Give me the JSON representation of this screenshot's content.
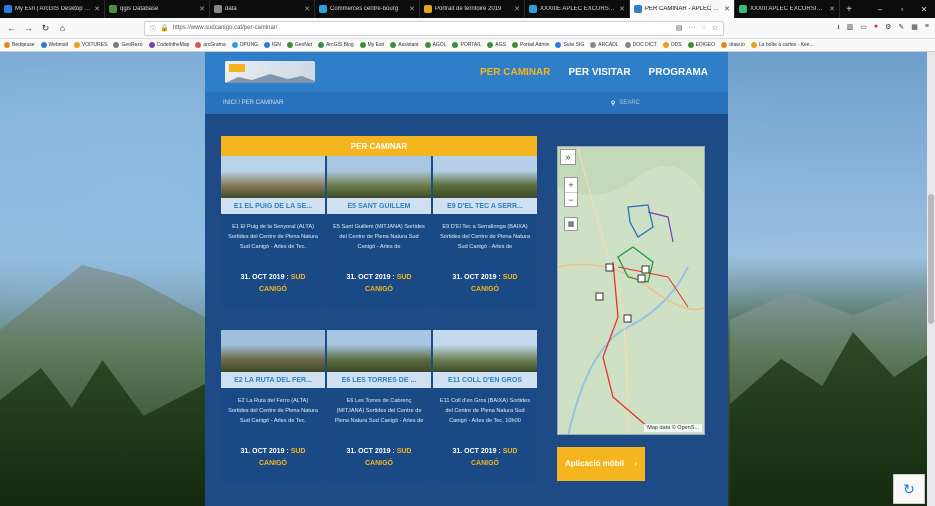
{
  "browser": {
    "tabs": [
      {
        "title": "My Esri | ArcGIS Desktop Sta",
        "color": "#2c7be5"
      },
      {
        "title": "qgis Database",
        "color": "#4a8f3f"
      },
      {
        "title": "data",
        "color": "#888888"
      },
      {
        "title": "Commerces centre-bourg",
        "color": "#2aa1d8"
      },
      {
        "title": "Portrait de territoire 2019",
        "color": "#e3a21a"
      },
      {
        "title": "XXXIIIE APLEC EXCURSIONI",
        "color": "#2aa1d8"
      },
      {
        "title": "PER CAMINAR - APLEC EXCU",
        "color": "#2f7fc8",
        "active": true
      },
      {
        "title": "XXXIII APLEC EXCURSIONIST",
        "color": "#3cb878"
      }
    ],
    "url": "https://www.sudcanigo.cat/per-caminar/",
    "bookmarks": [
      {
        "label": "Bedqeuse",
        "color": "#e38a1a"
      },
      {
        "label": "Webmail",
        "color": "#2c7be5"
      },
      {
        "label": "VOITURES",
        "color": "#e3a21a"
      },
      {
        "label": "GeoRezo",
        "color": "#7c7c7c"
      },
      {
        "label": "CodeIntheMap",
        "color": "#7b3fb5"
      },
      {
        "label": "arcGrama",
        "color": "#d55"
      },
      {
        "label": "OPUNG",
        "color": "#2aa1d8"
      },
      {
        "label": "IGN",
        "color": "#2c7be5"
      },
      {
        "label": "GeoNet",
        "color": "#3a8f3a"
      },
      {
        "label": "ArcGIS Blog",
        "color": "#3a8f3a"
      },
      {
        "label": "My Esri",
        "color": "#3a8f3a"
      },
      {
        "label": "Assistant",
        "color": "#3a8f3a"
      },
      {
        "label": "AGOL",
        "color": "#3a8f3a"
      },
      {
        "label": "PORTAIL",
        "color": "#3a8f3a"
      },
      {
        "label": "AGS",
        "color": "#3a8f3a"
      },
      {
        "label": "Portail Admin",
        "color": "#3a8f3a"
      },
      {
        "label": "Suivi SIG",
        "color": "#2c7be5"
      },
      {
        "label": "ARCADL",
        "color": "#888888"
      },
      {
        "label": "DOC DICT",
        "color": "#888888"
      },
      {
        "label": "ODS",
        "color": "#e3a21a"
      },
      {
        "label": "EDIGEO",
        "color": "#3a8f3a"
      },
      {
        "label": "draw.io",
        "color": "#e38a1a"
      },
      {
        "label": "La boîte à cartes - Kee...",
        "color": "#e3a21a"
      }
    ]
  },
  "site": {
    "menu": [
      "PER CAMINAR",
      "PER VISITAR",
      "PROGRAMA"
    ],
    "breadcrumb": "INICI  /  PER CAMINAR",
    "search_label": "SEARC",
    "section_title": "PER CAMINAR",
    "app_button": "Aplicació mòbil",
    "cards": [
      {
        "title": "E1 EL PUIG DE LA SE...",
        "desc": "E1 El Puig de la Senyoral (ALTA) Sortides del Centre de Plena Natura Sud Canigó - Arles de Tec.",
        "date": "31. OCT 2019 :",
        "loc": "SUD CANIGÓ",
        "sky": "#b8d3ea",
        "land": "#8a7a58"
      },
      {
        "title": "E5 SANT GUILLEM",
        "desc": "E5 Sant Guillem (MITJANA) Sortides del Centre de Plena Natura Sud Canigó - Arles de",
        "date": "31. OCT 2019 :",
        "loc": "SUD CANIGÓ",
        "sky": "#a9c7e2",
        "land": "#6e7f4a"
      },
      {
        "title": "E9 D'EL TEC A SERR...",
        "desc": "E9 D'El Tec a Serrallonga (BAIXA) Sortides del Centre de Plena Natura Sud Canigó - Arles de",
        "date": "31. OCT 2019 :",
        "loc": "SUD CANIGÓ",
        "sky": "#b5cfe6",
        "land": "#5a6f3a"
      },
      {
        "title": "E2 LA RUTA DEL FER...",
        "desc": "E2 La Ruta del Ferro (ALTA) Sortides del Centre de Plena Natura Sud Canigó - Arles de Tec.",
        "date": "31. OCT 2019 :",
        "loc": "SUD CANIGÓ",
        "sky": "#9fbfdd",
        "land": "#6d6a48"
      },
      {
        "title": "E6 LES TORRES DE ...",
        "desc": "E6 Les Torres de Cabrenç (MITJANA) Sortides del Centre de Plena Natura Sud Canigó - Arles de",
        "date": "31. OCT 2019 :",
        "loc": "SUD CANIGÓ",
        "sky": "#a7c6e3",
        "land": "#5c6e3f"
      },
      {
        "title": "E11 COLL D'EN GROS",
        "desc": "E11 Coll d'en Gros (BAIXA) Sortides del Centre de Plena Natura Sud Canigó - Arles de Tec. 10h00",
        "date": "31. OCT 2019 :",
        "loc": "SUD CANIGÓ",
        "sky": "#c2d9ee",
        "land": "#6f8456"
      }
    ],
    "map_attribution": "Map data © OpenS...",
    "map_collapse": "»",
    "zoom_in": "+",
    "zoom_out": "−"
  }
}
